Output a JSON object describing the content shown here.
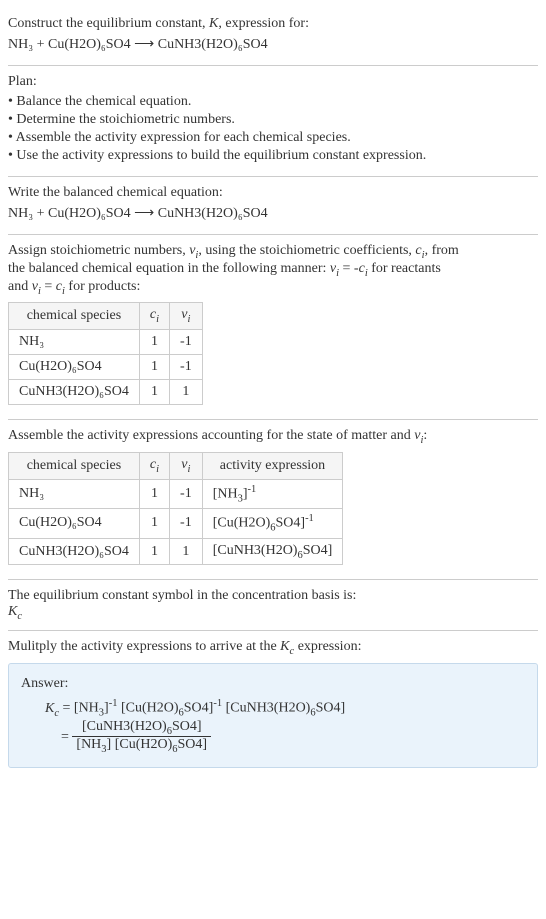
{
  "section1": {
    "line1": "Construct the equilibrium constant, K, expression for:",
    "equation": "NH₃ + Cu(H2O)₆SO4 ⟶ CuNH3(H2O)₆SO4"
  },
  "section2": {
    "title": "Plan:",
    "bullets": [
      "• Balance the chemical equation.",
      "• Determine the stoichiometric numbers.",
      "• Assemble the activity expression for each chemical species.",
      "• Use the activity expressions to build the equilibrium constant expression."
    ]
  },
  "section3": {
    "title": "Write the balanced chemical equation:",
    "equation": "NH₃ + Cu(H2O)₆SO4 ⟶ CuNH3(H2O)₆SO4"
  },
  "section4": {
    "intro1": "Assign stoichiometric numbers, νᵢ, using the stoichiometric coefficients, cᵢ, from",
    "intro2": "the balanced chemical equation in the following manner: νᵢ = -cᵢ for reactants",
    "intro3": "and νᵢ = cᵢ for products:",
    "headers": [
      "chemical species",
      "cᵢ",
      "νᵢ"
    ],
    "rows": [
      [
        "NH₃",
        "1",
        "-1"
      ],
      [
        "Cu(H2O)₆SO4",
        "1",
        "-1"
      ],
      [
        "CuNH3(H2O)₆SO4",
        "1",
        "1"
      ]
    ]
  },
  "section5": {
    "title": "Assemble the activity expressions accounting for the state of matter and νᵢ:",
    "headers": [
      "chemical species",
      "cᵢ",
      "νᵢ",
      "activity expression"
    ],
    "rows": [
      [
        "NH₃",
        "1",
        "-1",
        "[NH₃]⁻¹"
      ],
      [
        "Cu(H2O)₆SO4",
        "1",
        "-1",
        "[Cu(H2O)₆SO4]⁻¹"
      ],
      [
        "CuNH3(H2O)₆SO4",
        "1",
        "1",
        "[CuNH3(H2O)₆SO4]"
      ]
    ]
  },
  "section6": {
    "line1": "The equilibrium constant symbol in the concentration basis is:",
    "symbol": "K_c"
  },
  "section7": {
    "title": "Mulitply the activity expressions to arrive at the K_c expression:"
  },
  "answer": {
    "label": "Answer:",
    "line1": "K_c = [NH₃]⁻¹ [Cu(H2O)₆SO4]⁻¹ [CuNH3(H2O)₆SO4]",
    "eq_prefix": "= ",
    "frac_num": "[CuNH3(H2O)₆SO4]",
    "frac_den": "[NH₃] [Cu(H2O)₆SO4]"
  }
}
